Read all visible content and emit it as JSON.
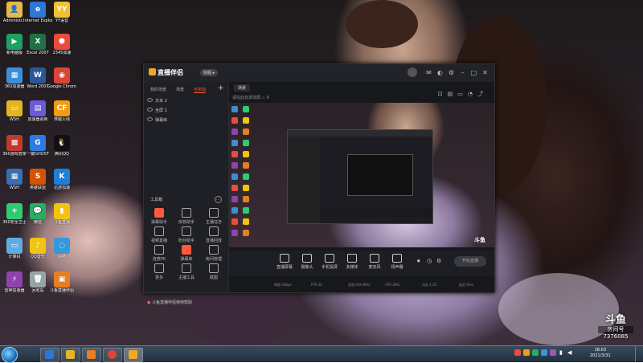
{
  "desktop": {
    "icons": [
      {
        "label": "Administr...",
        "color": "#e7b84a",
        "glyph": "👤"
      },
      {
        "label": "Internet Explorer",
        "color": "#2b78d6",
        "glyph": "e"
      },
      {
        "label": "YY语音",
        "color": "#f2c12e",
        "glyph": "YY"
      },
      {
        "label": "新电脑版",
        "color": "#1aa260",
        "glyph": "▶"
      },
      {
        "label": "Excel 2007",
        "color": "#1e7145",
        "glyph": "X"
      },
      {
        "label": "2345加速",
        "color": "#e84c3d",
        "glyph": "⬢"
      },
      {
        "label": "360加速器",
        "color": "#3b8ed8",
        "glyph": "▦"
      },
      {
        "label": "Word 2007",
        "color": "#2b5797",
        "glyph": "W"
      },
      {
        "label": "Google Chrome",
        "color": "#db4437",
        "glyph": "◉"
      },
      {
        "label": "WSH",
        "color": "#e6b422",
        "glyph": "▭"
      },
      {
        "label": "加速器更新",
        "color": "#6b5bd6",
        "glyph": "▤"
      },
      {
        "label": "穿越火线",
        "color": "#f39c12",
        "glyph": "CF"
      },
      {
        "label": "360游戏管家",
        "color": "#c0392b",
        "glyph": "▩"
      },
      {
        "label": "一键GHOST",
        "color": "#2c7be5",
        "glyph": "G"
      },
      {
        "label": "腾讯QQ",
        "color": "#111111",
        "glyph": "🐧"
      },
      {
        "label": "WSH",
        "color": "#3a6fb0",
        "glyph": "▦"
      },
      {
        "label": "英雄联盟",
        "color": "#d35400",
        "glyph": "S"
      },
      {
        "label": "迅游加速",
        "color": "#1d7fd8",
        "glyph": "K"
      },
      {
        "label": "360安全卫士",
        "color": "#2ecc71",
        "glyph": "+"
      },
      {
        "label": "微信",
        "color": "#27ae60",
        "glyph": "💬"
      },
      {
        "label": "斗鱼直播",
        "color": "#f1c40f",
        "glyph": "▮"
      },
      {
        "label": "计算机",
        "color": "#5dade2",
        "glyph": "▭"
      },
      {
        "label": "QQ音乐",
        "color": "#f1c40f",
        "glyph": "♪"
      },
      {
        "label": "网络",
        "color": "#3498db",
        "glyph": "◌"
      },
      {
        "label": "雷神加速器",
        "color": "#8e44ad",
        "glyph": "⚡"
      },
      {
        "label": "回收站",
        "color": "#95a5a6",
        "glyph": "🗑"
      },
      {
        "label": "斗鱼直播伴侣",
        "color": "#e67e22",
        "glyph": "▣"
      }
    ]
  },
  "app": {
    "title": "直播伴侣",
    "badge": "标版 ▸",
    "left_tabs": [
      "我的场景",
      "场景",
      "可添加"
    ],
    "layers": [
      "文本 2",
      "全屏 1",
      "弹幕库"
    ],
    "tools_header": "工具箱",
    "tools": [
      {
        "label": "弹幕助手",
        "hot": true
      },
      {
        "label": "房管助手",
        "hot": false
      },
      {
        "label": "主播任务",
        "hot": false
      },
      {
        "label": "视频直播",
        "hot": false
      },
      {
        "label": "粉丝助手",
        "hot": false
      },
      {
        "label": "直播回放",
        "hot": false
      },
      {
        "label": "连麦PK",
        "hot": false
      },
      {
        "label": "弹幕库",
        "hot": true
      },
      {
        "label": "房间管理",
        "hot": false
      },
      {
        "label": "更多",
        "hot": false
      },
      {
        "label": "主播工具",
        "hot": false
      },
      {
        "label": "截图",
        "hot": false
      }
    ],
    "notice": "斗鱼直播伴侣使用帮助",
    "scene_tab": "场景",
    "hint": "请在此处添加源",
    "hint_count": "0",
    "bottom_buttons": [
      "直播屏幕",
      "摄像头",
      "手机投屏",
      "多媒体",
      "麦克风",
      "扬声器"
    ],
    "golive_label": "开始直播",
    "status": [
      "网络 0Kbps",
      "FPS 30",
      "丢帧 0(0.00%)",
      "CPU 28%",
      "内存 1.2G",
      "延迟 0ms"
    ],
    "preview_logo": "斗鱼"
  },
  "taskbar": {
    "clock_time": "18:03",
    "clock_date": "2021/3/31"
  },
  "watermark": {
    "brand": "斗鱼",
    "room_label": "房间号",
    "room_number": "7376085"
  }
}
